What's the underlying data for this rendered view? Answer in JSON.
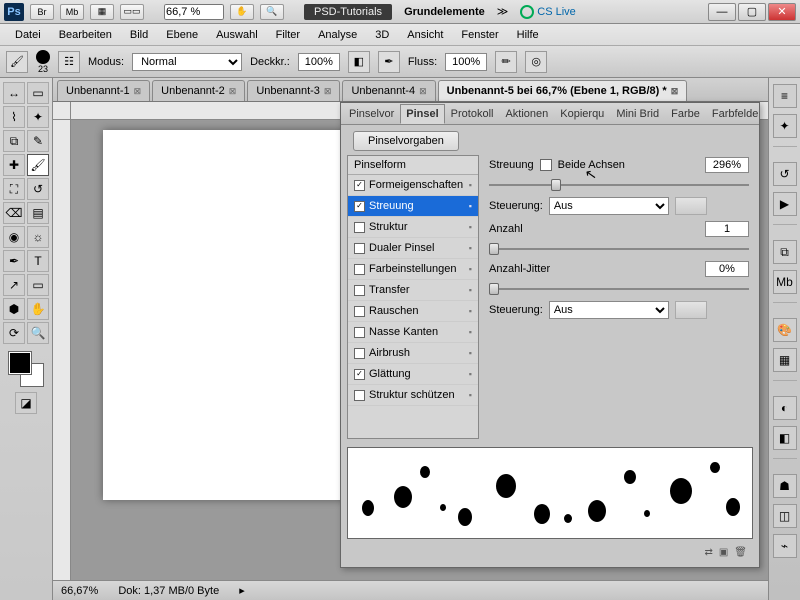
{
  "titlebar": {
    "ps": "Ps",
    "br": "Br",
    "mb": "Mb",
    "zoom": "66,7 %",
    "tutorials": "PSD-Tutorials",
    "docname": "Grundelemente",
    "cslive": "CS Live"
  },
  "menu": [
    "Datei",
    "Bearbeiten",
    "Bild",
    "Ebene",
    "Auswahl",
    "Filter",
    "Analyse",
    "3D",
    "Ansicht",
    "Fenster",
    "Hilfe"
  ],
  "optbar": {
    "brush_size": "23",
    "modus_label": "Modus:",
    "modus_value": "Normal",
    "deck_label": "Deckkr.:",
    "deck_value": "100%",
    "fluss_label": "Fluss:",
    "fluss_value": "100%"
  },
  "doctabs": [
    {
      "label": "Unbenannt-1",
      "active": false
    },
    {
      "label": "Unbenannt-2",
      "active": false
    },
    {
      "label": "Unbenannt-3",
      "active": false
    },
    {
      "label": "Unbenannt-4",
      "active": false
    },
    {
      "label": "Unbenannt-5 bei 66,7% (Ebene 1, RGB/8) *",
      "active": true
    }
  ],
  "status": {
    "zoom": "66,67%",
    "dok": "Dok: 1,37 MB/0 Byte"
  },
  "panel": {
    "tabs": [
      "Pinselvor",
      "Pinsel",
      "Protokoll",
      "Aktionen",
      "Kopierqu",
      "Mini Brid",
      "Farbe",
      "Farbfelde"
    ],
    "active_tab": "Pinsel",
    "preset_btn": "Pinselvorgaben",
    "list_header": "Pinselform",
    "items": [
      {
        "label": "Formeigenschaften",
        "checked": true,
        "locked": true,
        "sel": false
      },
      {
        "label": "Streuung",
        "checked": true,
        "locked": true,
        "sel": true
      },
      {
        "label": "Struktur",
        "checked": false,
        "locked": true,
        "sel": false
      },
      {
        "label": "Dualer Pinsel",
        "checked": false,
        "locked": true,
        "sel": false
      },
      {
        "label": "Farbeinstellungen",
        "checked": false,
        "locked": true,
        "sel": false
      },
      {
        "label": "Transfer",
        "checked": false,
        "locked": true,
        "sel": false
      },
      {
        "label": "Rauschen",
        "checked": false,
        "locked": true,
        "sel": false
      },
      {
        "label": "Nasse Kanten",
        "checked": false,
        "locked": true,
        "sel": false
      },
      {
        "label": "Airbrush",
        "checked": false,
        "locked": true,
        "sel": false
      },
      {
        "label": "Glättung",
        "checked": true,
        "locked": true,
        "sel": false
      },
      {
        "label": "Struktur schützen",
        "checked": false,
        "locked": true,
        "sel": false
      }
    ],
    "controls": {
      "streuung_label": "Streuung",
      "beide_achsen": "Beide Achsen",
      "streuung_value": "296%",
      "steuerung1_label": "Steuerung:",
      "steuerung1_value": "Aus",
      "anzahl_label": "Anzahl",
      "anzahl_value": "1",
      "jitter_label": "Anzahl-Jitter",
      "jitter_value": "0%",
      "steuerung2_label": "Steuerung:",
      "steuerung2_value": "Aus"
    }
  },
  "colors": {
    "accent": "#1a6bd8"
  }
}
